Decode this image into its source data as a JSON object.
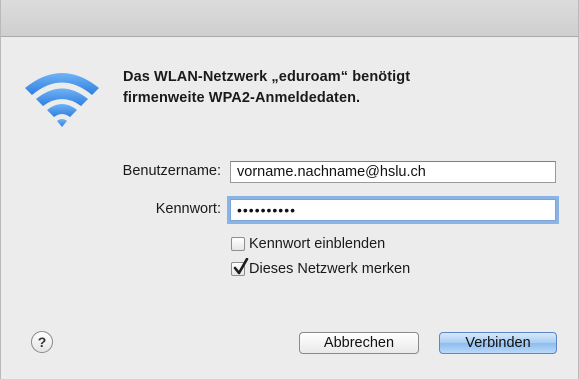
{
  "dialog": {
    "headline_line1": "Das WLAN-Netzwerk „eduroam“ benötigt",
    "headline_line2": "firmenweite WPA2-Anmeldedaten."
  },
  "form": {
    "username_label": "Benutzername:",
    "username_value": "vorname.nachname@hslu.ch",
    "password_label": "Kennwort:",
    "password_dots": "••••••••••"
  },
  "options": {
    "show_password_label": "Kennwort einblenden",
    "show_password_checked": false,
    "remember_network_label": "Dieses Netzwerk merken",
    "remember_network_checked": true
  },
  "buttons": {
    "help_label": "?",
    "cancel_label": "Abbrechen",
    "connect_label": "Verbinden"
  },
  "colors": {
    "dialog_background": "#ececec",
    "wifi_icon": "#3d8de8",
    "focus_ring": "#8ab3e6",
    "default_button": "#a9cdf3"
  },
  "icons": {
    "wifi": "wifi-icon",
    "help": "help-icon",
    "checkmark": "checkmark-icon"
  }
}
